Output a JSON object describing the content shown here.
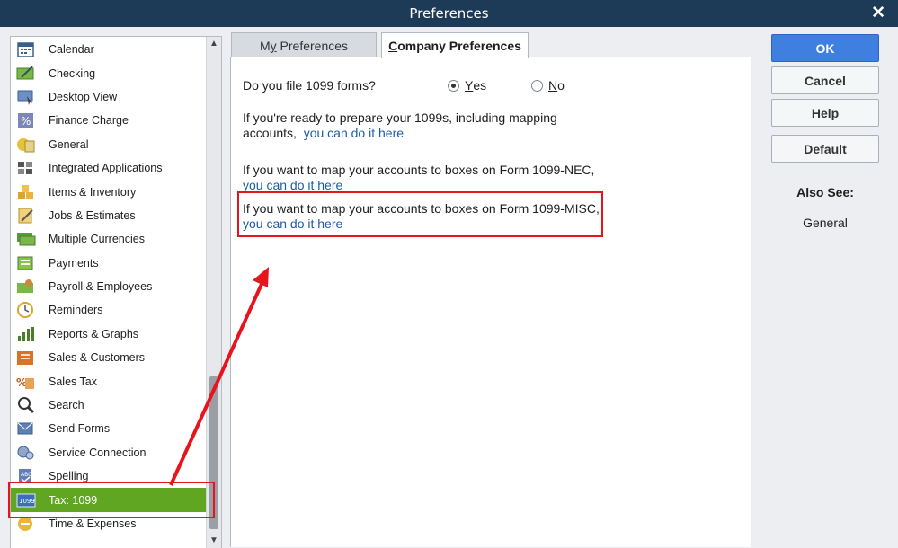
{
  "window": {
    "title": "Preferences",
    "close_glyph": "✕"
  },
  "sidebar": {
    "items": [
      {
        "label": "Calendar",
        "icon": "calendar-icon"
      },
      {
        "label": "Checking",
        "icon": "checking-icon"
      },
      {
        "label": "Desktop View",
        "icon": "desktop-view-icon"
      },
      {
        "label": "Finance Charge",
        "icon": "finance-charge-icon"
      },
      {
        "label": "General",
        "icon": "general-icon"
      },
      {
        "label": "Integrated Applications",
        "icon": "integrated-applications-icon"
      },
      {
        "label": "Items & Inventory",
        "icon": "items-inventory-icon"
      },
      {
        "label": "Jobs & Estimates",
        "icon": "jobs-estimates-icon"
      },
      {
        "label": "Multiple Currencies",
        "icon": "multiple-currencies-icon"
      },
      {
        "label": "Payments",
        "icon": "payments-icon"
      },
      {
        "label": "Payroll & Employees",
        "icon": "payroll-employees-icon"
      },
      {
        "label": "Reminders",
        "icon": "reminders-icon"
      },
      {
        "label": "Reports & Graphs",
        "icon": "reports-graphs-icon"
      },
      {
        "label": "Sales & Customers",
        "icon": "sales-customers-icon"
      },
      {
        "label": "Sales Tax",
        "icon": "sales-tax-icon"
      },
      {
        "label": "Search",
        "icon": "search-icon"
      },
      {
        "label": "Send Forms",
        "icon": "send-forms-icon"
      },
      {
        "label": "Service Connection",
        "icon": "service-connection-icon"
      },
      {
        "label": "Spelling",
        "icon": "spelling-icon"
      },
      {
        "label": "Tax: 1099",
        "icon": "tax-1099-icon",
        "selected": true,
        "badge": "1099"
      },
      {
        "label": "Time & Expenses",
        "icon": "time-expenses-icon"
      }
    ],
    "scroll_up_glyph": "▲",
    "scroll_down_glyph": "▼"
  },
  "tabs": {
    "my_preferences": {
      "prefix": "M",
      "accel": "y",
      "rest": " Preferences"
    },
    "company_preferences": {
      "accel": "C",
      "rest": "ompany Preferences"
    }
  },
  "content": {
    "question": "Do you file 1099 forms?",
    "yes": {
      "accel": "Y",
      "rest": "es",
      "checked": true
    },
    "no": {
      "accel": "N",
      "rest": "o",
      "checked": false
    },
    "para1_line1": "If you're ready to prepare your 1099s, including mapping",
    "para1_line2": "accounts,",
    "para1_link": "you can do it here",
    "para2_line1": "If you want to map your accounts to boxes on Form 1099-NEC,",
    "para2_link": "you can do it here",
    "para3_line1": "If you want to map your accounts to boxes on Form 1099-MISC,",
    "para3_link": "you can do it here"
  },
  "buttons": {
    "ok": "OK",
    "cancel": "Cancel",
    "help": "Help",
    "default": {
      "accel": "D",
      "rest": "efault"
    }
  },
  "also_see": {
    "heading": "Also See:",
    "items": [
      "General"
    ]
  },
  "colors": {
    "titlebar": "#1d3a56",
    "selected_item": "#61a622",
    "ok_button": "#3e7fe0",
    "link": "#1d5ba8",
    "annotation_red": "#e8141d"
  }
}
